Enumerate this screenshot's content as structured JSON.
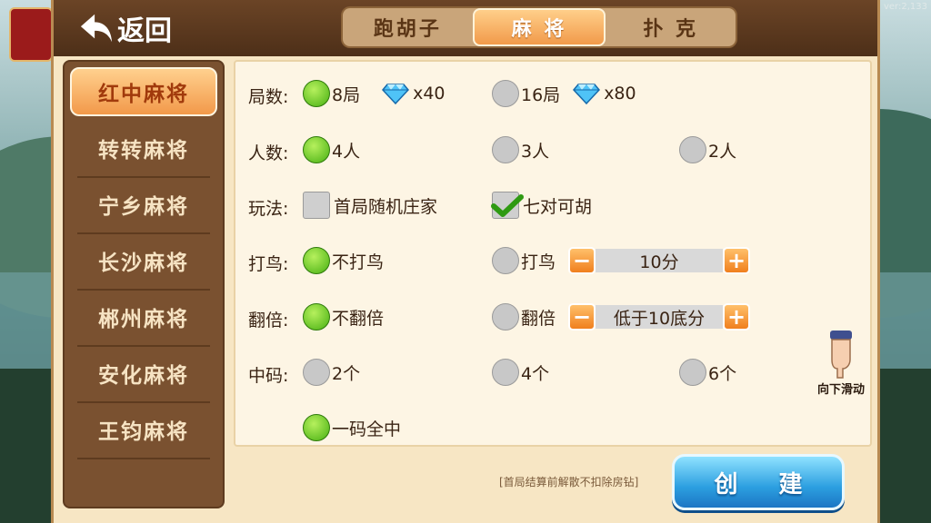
{
  "version": "ver:2,133",
  "header": {
    "back_label": "返回"
  },
  "tabs": [
    {
      "label": "跑胡子",
      "active": false
    },
    {
      "label": "麻 将",
      "active": true
    },
    {
      "label": "扑 克",
      "active": false
    }
  ],
  "sidebar": {
    "items": [
      {
        "label": "红中麻将",
        "active": true
      },
      {
        "label": "转转麻将",
        "active": false
      },
      {
        "label": "宁乡麻将",
        "active": false
      },
      {
        "label": "长沙麻将",
        "active": false
      },
      {
        "label": "郴州麻将",
        "active": false
      },
      {
        "label": "安化麻将",
        "active": false
      },
      {
        "label": "王钧麻将",
        "active": false
      }
    ]
  },
  "options": {
    "rounds": {
      "label": "局数:",
      "choices": [
        {
          "text": "8局",
          "cost": "x40",
          "selected": true
        },
        {
          "text": "16局",
          "cost": "x80",
          "selected": false
        }
      ]
    },
    "players": {
      "label": "人数:",
      "choices": [
        {
          "text": "4人",
          "selected": true
        },
        {
          "text": "3人",
          "selected": false
        },
        {
          "text": "2人",
          "selected": false
        }
      ]
    },
    "rules": {
      "label": "玩法:",
      "choices": [
        {
          "text": "首局随机庄家",
          "checked": false
        },
        {
          "text": "七对可胡",
          "checked": true
        }
      ]
    },
    "bird": {
      "label": "打鸟:",
      "choices": [
        {
          "text": "不打鸟",
          "selected": true
        },
        {
          "text": "打鸟",
          "selected": false
        }
      ],
      "stepper_value": "10分"
    },
    "double": {
      "label": "翻倍:",
      "choices": [
        {
          "text": "不翻倍",
          "selected": true
        },
        {
          "text": "翻倍",
          "selected": false
        }
      ],
      "stepper_value": "低于10底分"
    },
    "code": {
      "label": "中码:",
      "choices": [
        {
          "text": "2个",
          "selected": false
        },
        {
          "text": "4个",
          "selected": false
        },
        {
          "text": "6个",
          "selected": false
        },
        {
          "text": "一码全中",
          "selected": true
        }
      ]
    }
  },
  "scroll_hint": "向下滑动",
  "notice": "[首局结算前解散不扣除房钻]",
  "create_label": "创 建",
  "colors": {
    "accent_orange": "#f19a4a",
    "selected_green": "#47b012",
    "create_blue": "#2c9fe0",
    "panel_bg": "#f7e6c4"
  }
}
